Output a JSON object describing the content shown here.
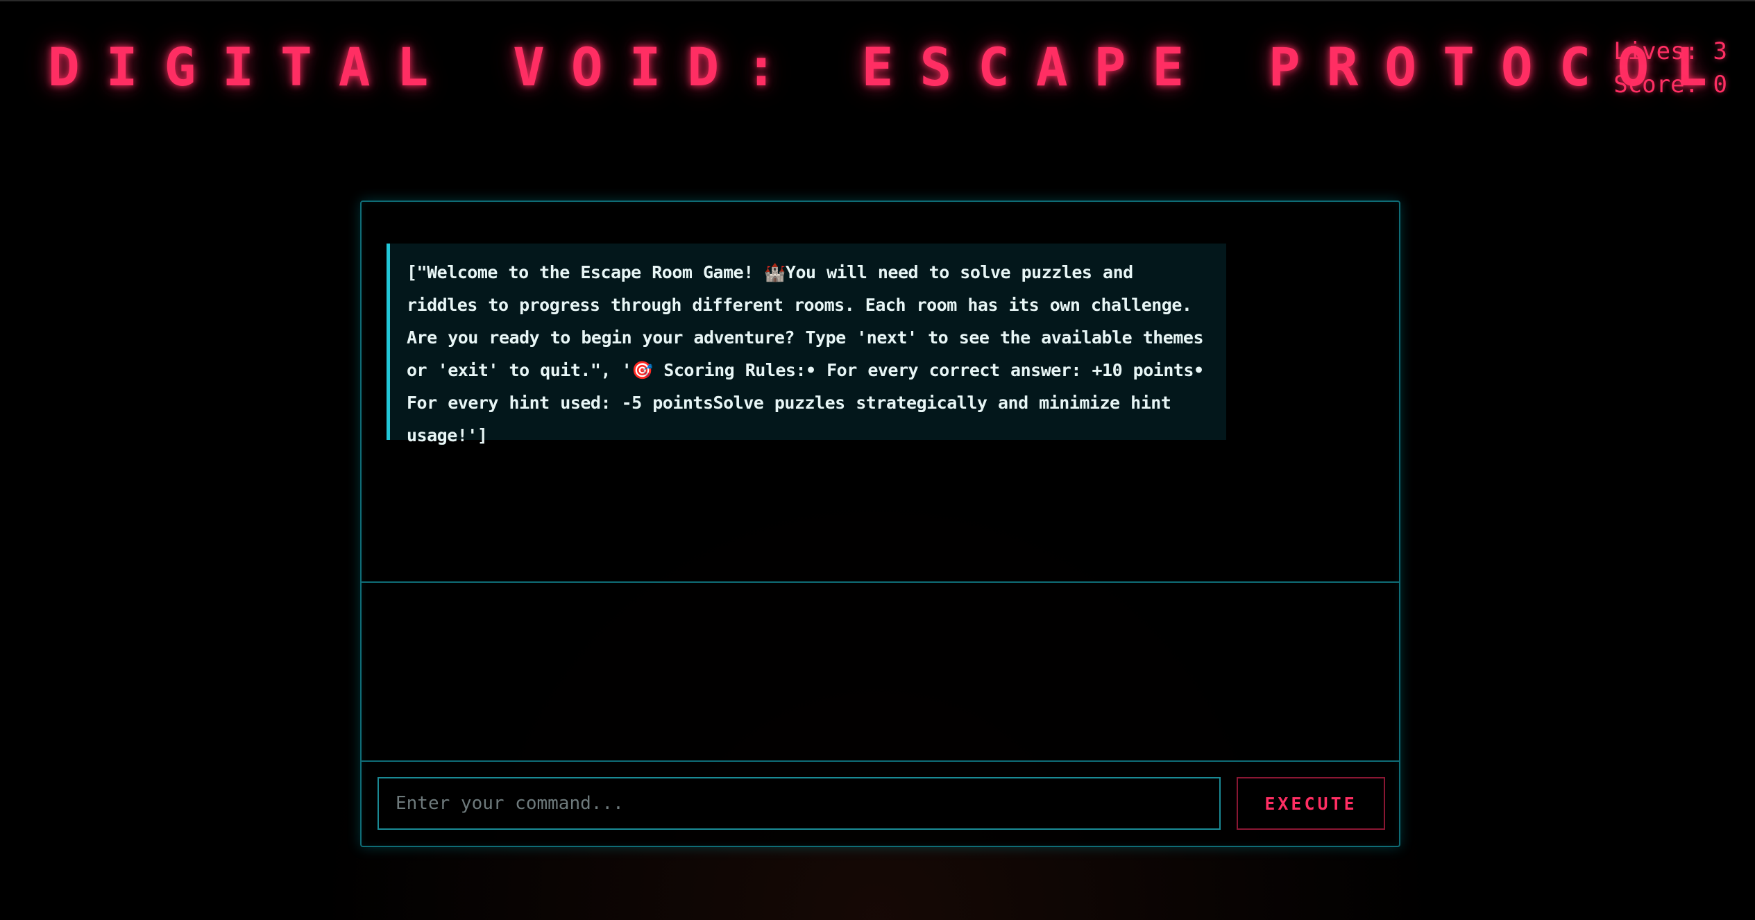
{
  "game": {
    "title": "DIGITAL VOID: ESCAPE PROTOCOL"
  },
  "stats": {
    "lives_label": "Lives: 3",
    "score_label": "Score: 0",
    "lives": 3,
    "score": 0
  },
  "output": {
    "message": "[\"Welcome to the Escape Room Game! 🏰You will need to solve puzzles and riddles to progress through different rooms. Each room has its own challenge. Are you ready to begin your adventure? Type 'next' to see the available themes or 'exit' to quit.\", '🎯 Scoring Rules:• For every correct answer: +10 points• For every hint used: -5 pointsSolve puzzles strategically and minimize hint usage!']"
  },
  "command": {
    "placeholder": "Enter your command...",
    "value": "",
    "execute_label": "EXECUTE"
  },
  "colors": {
    "accent_pink": "#ff2e63",
    "accent_cyan": "#22c7d8",
    "border_teal": "#0f6c76",
    "background": "#000000"
  }
}
